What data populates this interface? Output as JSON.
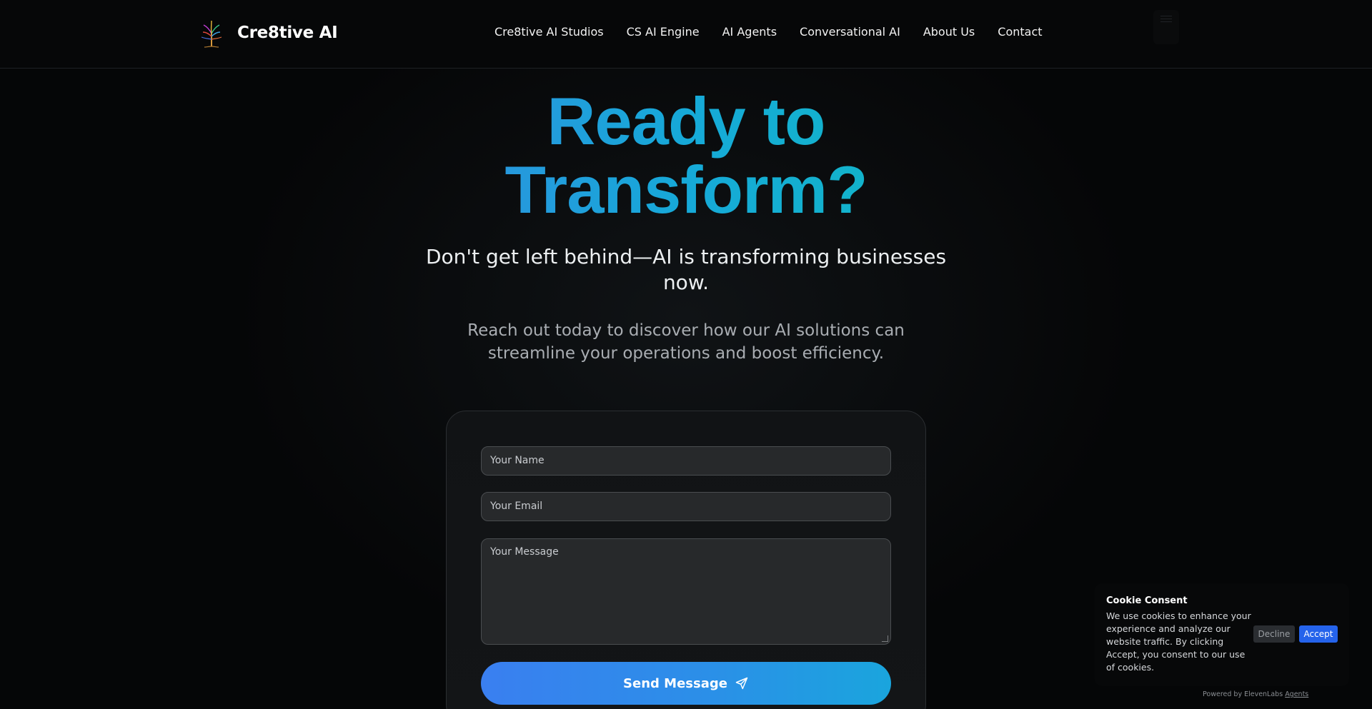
{
  "header": {
    "brand_name": "Cre8tive AI",
    "logo_icon": "tree-icon",
    "nav": [
      "Cre8tive AI Studios",
      "CS AI Engine",
      "AI Agents",
      "Conversational AI",
      "About Us",
      "Contact"
    ]
  },
  "hero": {
    "title_line1": "Ready to",
    "title_line2": "Transform?",
    "subtitle": "Don't get left behind—AI is transforming businesses now.",
    "description": "Reach out today to discover how our AI solutions can streamline your operations and boost efficiency."
  },
  "form": {
    "name_placeholder": "Your Name",
    "email_placeholder": "Your Email",
    "message_placeholder": "Your Message",
    "submit_label": "Send Message",
    "submit_icon": "send-icon"
  },
  "cookie": {
    "title": "Cookie Consent",
    "text": "We use cookies to enhance your experience and analyze our website traffic. By clicking Accept, you consent to our use of cookies.",
    "decline_label": "Decline",
    "accept_label": "Accept"
  },
  "footer": {
    "powered_prefix": "Powered by ElevenLabs",
    "powered_link": "Agents"
  },
  "colors": {
    "background": "#050607",
    "accent_blue": "#2563eb",
    "title_gradient_start": "#2f8fe0",
    "title_gradient_end": "#10b9c4",
    "button_gradient_start": "#3a7ff0",
    "button_gradient_end": "#1aa5dd"
  }
}
